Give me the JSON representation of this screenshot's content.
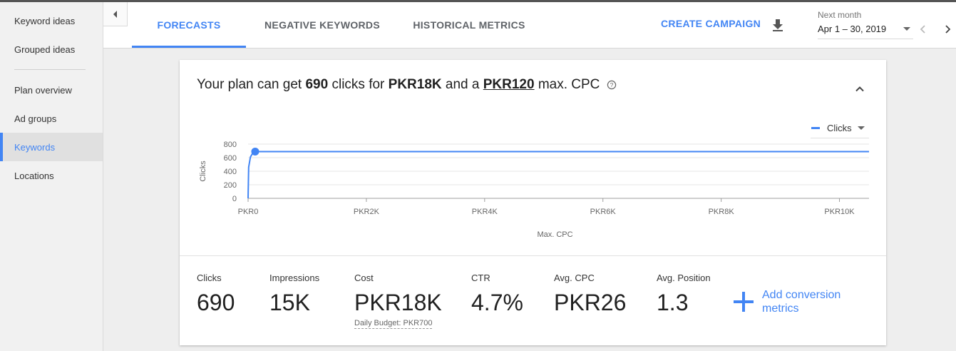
{
  "sidebar": {
    "items": [
      {
        "label": "Keyword ideas",
        "active": false
      },
      {
        "label": "Grouped ideas",
        "active": false
      },
      {
        "label": "Plan overview",
        "active": false
      },
      {
        "label": "Ad groups",
        "active": false
      },
      {
        "label": "Keywords",
        "active": true
      },
      {
        "label": "Locations",
        "active": false
      }
    ]
  },
  "tabs": [
    {
      "label": "FORECASTS",
      "active": true
    },
    {
      "label": "NEGATIVE KEYWORDS",
      "active": false
    },
    {
      "label": "HISTORICAL METRICS",
      "active": false
    }
  ],
  "toolbar": {
    "create_campaign": "CREATE CAMPAIGN",
    "download_icon": "download-icon",
    "date_label": "Next month",
    "date_value": "Apr 1 – 30, 2019"
  },
  "forecast": {
    "headline": {
      "part1": "Your plan can get ",
      "clicks": "690",
      "part2": " clicks for ",
      "cost": "PKR18K",
      "part3": " and a ",
      "cpc": "PKR120",
      "part4": " max. CPC"
    },
    "legend_label": "Clicks",
    "metrics": [
      {
        "label": "Clicks",
        "value": "690"
      },
      {
        "label": "Impressions",
        "value": "15K"
      },
      {
        "label": "Cost",
        "value": "PKR18K",
        "sub": "Daily Budget: PKR700"
      },
      {
        "label": "CTR",
        "value": "4.7%"
      },
      {
        "label": "Avg. CPC",
        "value": "PKR26"
      },
      {
        "label": "Avg. Position",
        "value": "1.3"
      }
    ],
    "add_conversion": {
      "line1": "Add conversion",
      "line2": "metrics"
    }
  },
  "colors": {
    "accent": "#4285f4"
  },
  "chart_data": {
    "type": "line",
    "xlabel": "Max. CPC",
    "ylabel": "Clicks",
    "x_ticks": [
      "PKR0",
      "PKR2K",
      "PKR4K",
      "PKR6K",
      "PKR8K",
      "PKR10K"
    ],
    "y_ticks": [
      "0",
      "200",
      "400",
      "600",
      "800"
    ],
    "xlim": [
      0,
      10500
    ],
    "ylim": [
      0,
      800
    ],
    "grid": true,
    "series": [
      {
        "name": "Clicks",
        "x": [
          0,
          10,
          40,
          80,
          120,
          10500
        ],
        "y": [
          0,
          460,
          610,
          670,
          690,
          690
        ]
      }
    ],
    "highlight_point": {
      "x": 120,
      "y": 690
    }
  }
}
